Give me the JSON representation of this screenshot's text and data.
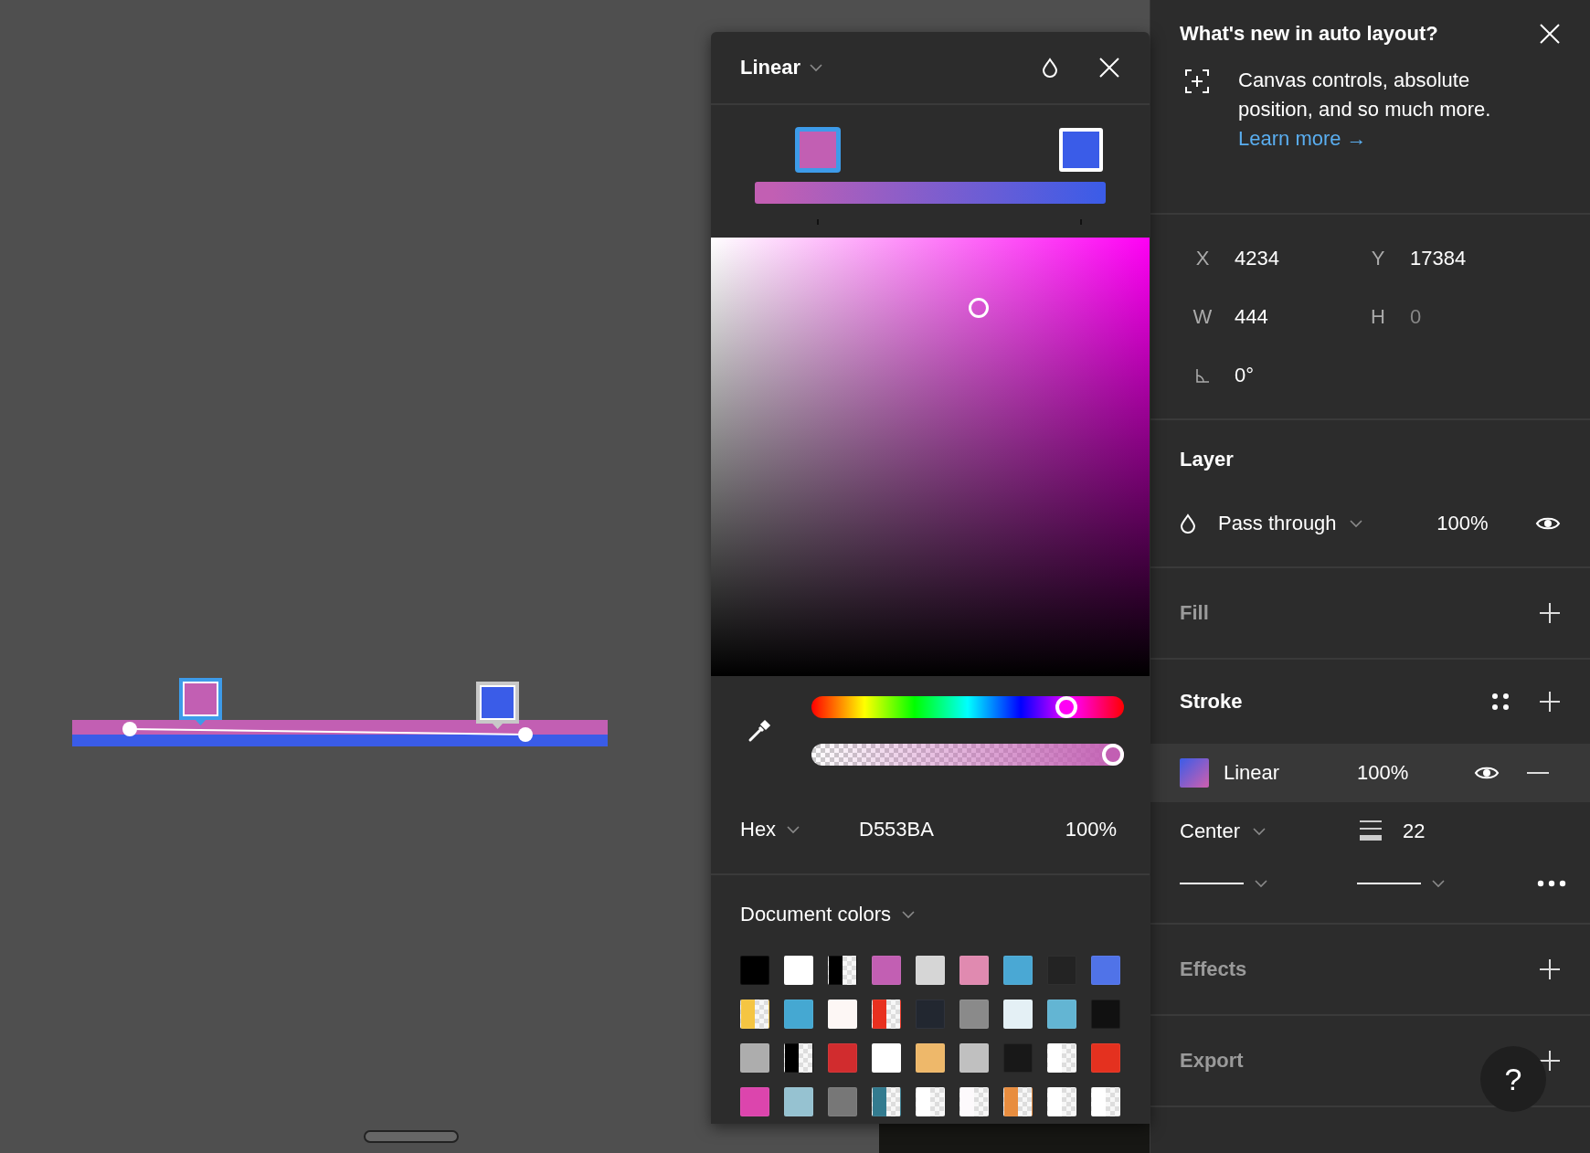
{
  "canvas": {
    "stops": [
      {
        "color": "#c25fb3",
        "selected": true
      },
      {
        "color": "#3a5ce8",
        "selected": false
      }
    ]
  },
  "color_picker": {
    "type": "Linear",
    "stops": [
      {
        "color": "#c25fb3",
        "selected": true
      },
      {
        "color": "#3a5ce8",
        "selected": false
      }
    ],
    "hue": {
      "level": 0.84
    },
    "opacity": {
      "level": 1
    },
    "format": "Hex",
    "hex_value": "D553BA",
    "opacity_value": "100%",
    "library": "Document colors",
    "swatches": [
      {
        "color": "#000000",
        "kind": "solid"
      },
      {
        "color": "#ffffff",
        "kind": "solid"
      },
      {
        "color": "#000000",
        "kind": "split"
      },
      {
        "color": "#c25fb3",
        "kind": "solid"
      },
      {
        "color": "#d6d6d6",
        "kind": "solid"
      },
      {
        "color": "#e08ab0",
        "kind": "solid"
      },
      {
        "color": "#4aa8d4",
        "kind": "solid"
      },
      {
        "color": "#232323",
        "kind": "solid"
      },
      {
        "color": "#5073e8",
        "kind": "solid"
      },
      {
        "color": "#f5c542",
        "kind": "split"
      },
      {
        "color": "#45a8d2",
        "kind": "solid"
      },
      {
        "color": "#fdf7f5",
        "kind": "solid"
      },
      {
        "color": "#e8301f",
        "kind": "split"
      },
      {
        "color": "#222730",
        "kind": "solid"
      },
      {
        "color": "#8a8a8a",
        "kind": "solid"
      },
      {
        "color": "#e4f0f5",
        "kind": "solid"
      },
      {
        "color": "#63b5d3",
        "kind": "solid"
      },
      {
        "color": "#111111",
        "kind": "solid"
      },
      {
        "color": "#adadad",
        "kind": "solid"
      },
      {
        "color": "#000000",
        "kind": "split"
      },
      {
        "color": "#d12c2e",
        "kind": "solid"
      },
      {
        "color": "#ffffff",
        "kind": "solid"
      },
      {
        "color": "#eeb86a",
        "kind": "solid"
      },
      {
        "color": "#c0c0c0",
        "kind": "solid"
      },
      {
        "color": "#181818",
        "kind": "solid"
      },
      {
        "color": "#ffffff",
        "kind": "split"
      },
      {
        "color": "#e4311f",
        "kind": "solid"
      },
      {
        "color": "#dc45ad",
        "kind": "solid"
      },
      {
        "color": "#96c2d1",
        "kind": "solid"
      },
      {
        "color": "#777777",
        "kind": "solid"
      },
      {
        "color": "#337b8f",
        "kind": "split"
      },
      {
        "color": "#ffffff",
        "kind": "split"
      },
      {
        "color": "#fdfafc",
        "kind": "split"
      },
      {
        "color": "#e88d3f",
        "kind": "split"
      },
      {
        "color": "#ffffff",
        "kind": "split"
      },
      {
        "color": "#ffffff",
        "kind": "split"
      }
    ]
  },
  "announcement": {
    "title": "What's new in auto layout?",
    "body": "Canvas controls, absolute position, and so much more.",
    "link": "Learn more →"
  },
  "geometry": [
    {
      "label": "X",
      "value": "4234",
      "disabled": false
    },
    {
      "label": "Y",
      "value": "17384",
      "disabled": false
    },
    {
      "label": "W",
      "value": "444",
      "disabled": false
    },
    {
      "label": "H",
      "value": "0",
      "disabled": true
    }
  ],
  "rotation": "0°",
  "layer": {
    "title": "Layer",
    "blend": "Pass through",
    "opacity": "100%"
  },
  "fill": {
    "title": "Fill",
    "muted": true
  },
  "stroke": {
    "title": "Stroke",
    "muted": false,
    "paint": {
      "type": "Linear",
      "opacity": "100%",
      "selected": true
    },
    "align": "Center",
    "weight": "22"
  },
  "effects": {
    "title": "Effects",
    "muted": true
  },
  "export": {
    "title": "Export",
    "muted": true
  },
  "help": "?"
}
